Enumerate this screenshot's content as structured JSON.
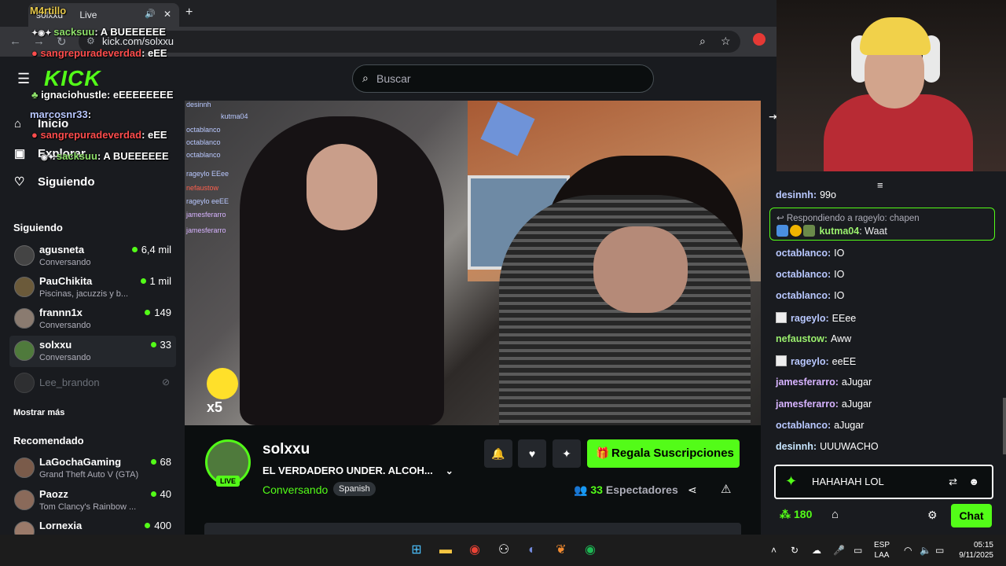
{
  "browser": {
    "tab_label": "solxxu",
    "tab_live": "Live",
    "url": "kick.com/solxxu"
  },
  "header": {
    "search_placeholder": "Buscar"
  },
  "sidebar": {
    "menu": [
      {
        "label": "Inicio"
      },
      {
        "label": "Explorar"
      },
      {
        "label": "Siguiendo"
      }
    ],
    "following_title": "Siguiendo",
    "following": [
      {
        "name": "agusneta",
        "category": "Conversando",
        "viewers": "6,4 mil"
      },
      {
        "name": "PauChikita",
        "category": "Piscinas, jacuzzis y b...",
        "viewers": "1 mil"
      },
      {
        "name": "frannn1x",
        "category": "Conversando",
        "viewers": "149"
      },
      {
        "name": "solxxu",
        "category": "Conversando",
        "viewers": "33"
      }
    ],
    "offline": {
      "name": "Lee_brandon"
    },
    "show_more": "Mostrar más",
    "recommended_title": "Recomendado",
    "recommended": [
      {
        "name": "LaGochaGaming",
        "category": "Grand Theft Auto V (GTA)",
        "viewers": "68"
      },
      {
        "name": "Paozz",
        "category": "Tom Clancy's Rainbow ...",
        "viewers": "40"
      },
      {
        "name": "Lornexia",
        "category": "",
        "viewers": "400"
      }
    ]
  },
  "stream": {
    "channel": "solxxu",
    "live": "LIVE",
    "title": "EL VERDADERO UNDER. ALCOH...",
    "category": "Conversando",
    "tag": "Spanish",
    "subscribe": "Regala Suscripciones",
    "viewers": "33",
    "viewers_label": "Espectadores",
    "sticker_mult": "x5"
  },
  "overlay": {
    "lines": [
      {
        "user": "M4rtillo",
        "text": ""
      },
      {
        "user": "sacksuu",
        "text": ": A BUEEEEEE"
      },
      {
        "user": "sangrepuradeverdad",
        "text": ": eEE"
      },
      {
        "user": "ignaciohustle",
        "text": ": eEEEEEEEE"
      },
      {
        "user": "marcosnr33",
        "text": ":"
      },
      {
        "user": "sangrepuradeverdad",
        "text": ": eEE"
      },
      {
        "user": "sacksuu",
        "text": ": A BUEEEEEE"
      }
    ],
    "logo": "KICK"
  },
  "video_overlay": {
    "lines": [
      {
        "user": "desinnh",
        "text": ""
      },
      {
        "user": "kutma04",
        "text": ""
      },
      {
        "user": "octablanco",
        "text": ""
      },
      {
        "user": "octablanco",
        "text": ""
      },
      {
        "user": "octablanco",
        "text": ""
      },
      {
        "user": "rageylo",
        "text": "EEee"
      },
      {
        "user": "nefaustow",
        "text": ""
      },
      {
        "user": "rageylo",
        "text": "eeEE"
      },
      {
        "user": "jamesferarro",
        "text": ""
      },
      {
        "user": "jamesferarro",
        "text": ""
      }
    ]
  },
  "chat": {
    "first_partial": {
      "user": "desinnh",
      "text": "99o"
    },
    "reply": {
      "header": "Respondiendo a rageylo: chapen",
      "user": "kutma04",
      "text": "Waat"
    },
    "messages": [
      {
        "user": "octablanco",
        "text": "IO",
        "color": "blue"
      },
      {
        "user": "octablanco",
        "text": "IO",
        "color": "blue"
      },
      {
        "user": "octablanco",
        "text": "IO",
        "color": "blue"
      },
      {
        "user": "rageylo",
        "text": "EEee",
        "color": "blue",
        "badge": true
      },
      {
        "user": "nefaustow",
        "text": "Aww",
        "color": "green"
      },
      {
        "user": "rageylo",
        "text": "eeEE",
        "color": "blue",
        "badge": true
      },
      {
        "user": "jamesferarro",
        "text": "aJugar",
        "color": "purple"
      },
      {
        "user": "jamesferarro",
        "text": "aJugar",
        "color": "purple"
      },
      {
        "user": "octablanco",
        "text": "aJugar",
        "color": "blue"
      },
      {
        "user": "desinnh",
        "text": "UUUWACHO",
        "color": "light"
      }
    ],
    "input_value": "HAHAHAH LOL",
    "points": "180",
    "chat_button": "Chat"
  },
  "taskbar": {
    "lang_line1": "ESP",
    "lang_line2": "LAA",
    "time": "05:15",
    "date": "9/11/2025"
  }
}
